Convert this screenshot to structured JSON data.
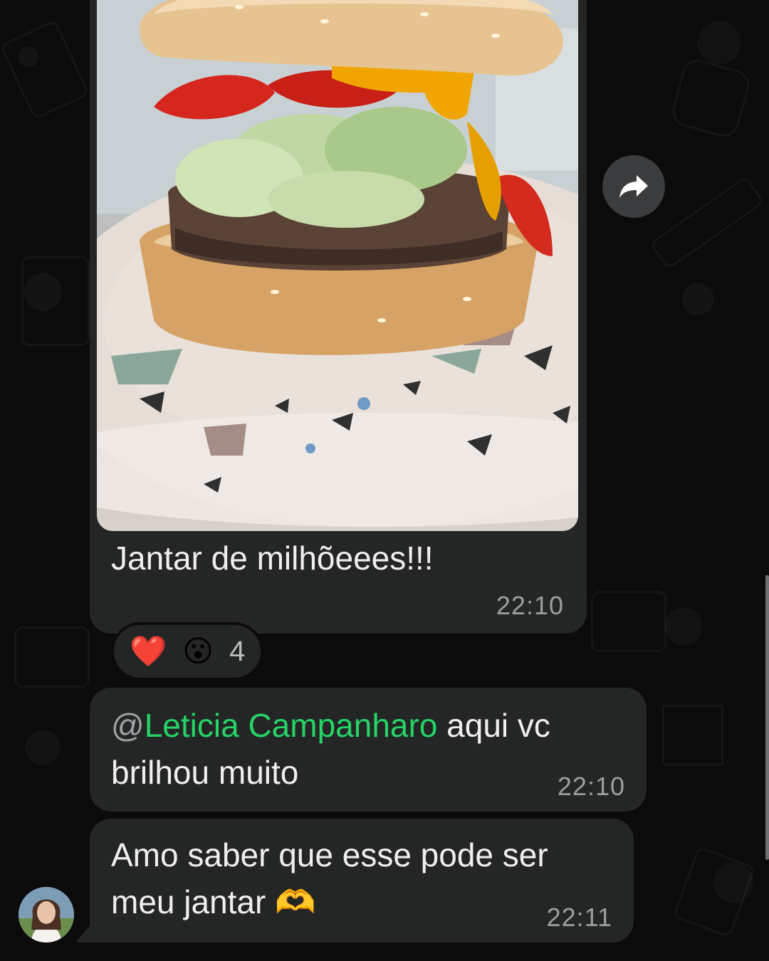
{
  "message_photo": {
    "caption": "Jantar de milhõeees!!!",
    "time": "22:10",
    "image_description_icon": "burger-photo"
  },
  "reactions": {
    "emojis": [
      "❤️",
      "😮"
    ],
    "count": "4"
  },
  "forward_button": {
    "icon": "forward-arrow-icon"
  },
  "message_mention": {
    "at_symbol": "@",
    "mention_name": "Leticia Campanharo",
    "text_after": " aqui vc brilhou muito",
    "time": "22:10"
  },
  "message_reply": {
    "text": "Amo saber que esse pode ser meu jantar 🫶",
    "time": "22:11"
  },
  "colors": {
    "bubble": "#242626",
    "background": "#0b0b0b",
    "mention": "#25d366",
    "timestamp": "#9b9e9f"
  }
}
